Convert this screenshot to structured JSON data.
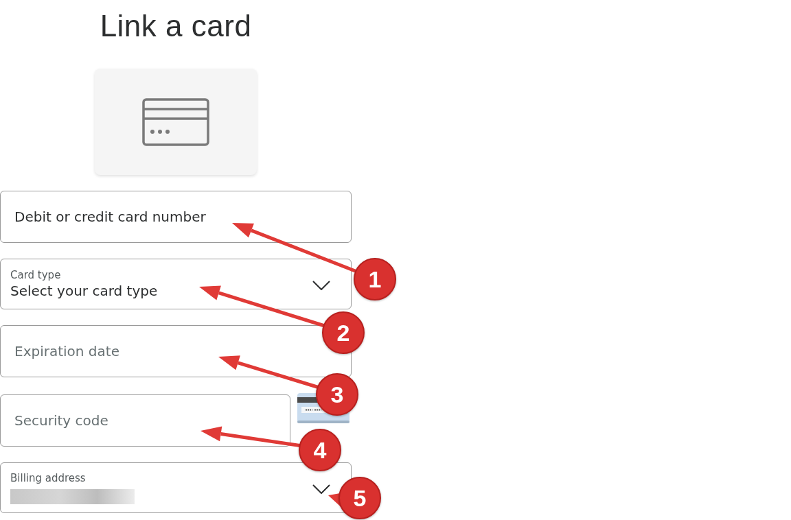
{
  "title": "Link a card",
  "fields": [
    {
      "kind": "input",
      "placeholder": "Debit or credit card number",
      "focused": true
    },
    {
      "kind": "select",
      "label": "Card type",
      "value": "Select your card type"
    },
    {
      "kind": "input",
      "placeholder": "Expiration date",
      "focused": false
    },
    {
      "kind": "cvv",
      "placeholder": "Security code",
      "focused": false
    },
    {
      "kind": "select",
      "label": "Billing address",
      "value_redacted": true
    }
  ],
  "annotations": [
    {
      "number": "1"
    },
    {
      "number": "2"
    },
    {
      "number": "3"
    },
    {
      "number": "4"
    },
    {
      "number": "5"
    }
  ]
}
